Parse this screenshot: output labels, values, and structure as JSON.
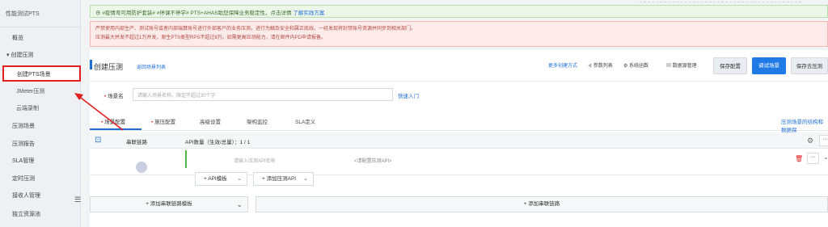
{
  "sidebar": {
    "title": "性能测试PTS",
    "items": [
      {
        "label": "概览"
      },
      {
        "label": "创建压测",
        "group": true
      },
      {
        "label": "创建PTS场景",
        "active": true
      },
      {
        "label": "JMeter压测"
      },
      {
        "label": "云端录制"
      },
      {
        "label": "压测场景"
      },
      {
        "label": "压测报告"
      },
      {
        "label": "SLA管理"
      },
      {
        "label": "定时压测"
      },
      {
        "label": "接收人管理"
      },
      {
        "label": "独立资源池"
      }
    ],
    "group_arrow": "▾",
    "collapse_glyph": "☰"
  },
  "notice": {
    "icon": "⊕",
    "text": "#疫情弯可用防护套装# #停课不停学# PTS+AHAS助您保障业务稳定性，点击详情",
    "link": "了解实践方案"
  },
  "warning": {
    "line1": "严禁使用内部生产、测试账号或者内部端算账号进行外部客户的业务压测，进行为触及安全和属正底线，一经发现将封禁账号资源并同步到相关部门。",
    "line2": "压测最大并发不超过1万并发，原生PTS类型RPS不超过8万。如需更高压测能力，请在邮件内PD申请报备。"
  },
  "header": {
    "title": "创建压测",
    "subtitle": "返回场景列表",
    "more_create": "更多创建方式",
    "param_list": "参数列表",
    "sys_func": "系统函数",
    "data_source": "数据源管理",
    "save_config": "保存配置",
    "debug_scene": "调试场景",
    "save_start": "保存去压测"
  },
  "scene": {
    "label": "场景名",
    "placeholder": "请输入场景名称，限定不超过30个字",
    "quick_entry": "快速入门"
  },
  "tabs": [
    "场景配置",
    "施压配置",
    "高级设置",
    "架构监控",
    "SLA定义"
  ],
  "tab_right": "压测场景的结构和数据保",
  "chain": {
    "label": "串联链路",
    "api_count": "API数量（生效/总量）：1 / 1"
  },
  "api": {
    "name_placeholder": "请输入压测API名称",
    "config_text": "<请配置压测API>"
  },
  "dropdowns": {
    "api_template": "API模板",
    "add_api": "添加压测API"
  },
  "add_rows": {
    "chain_template": "添加串联链路模板",
    "add_chain": "添加串联链路"
  }
}
